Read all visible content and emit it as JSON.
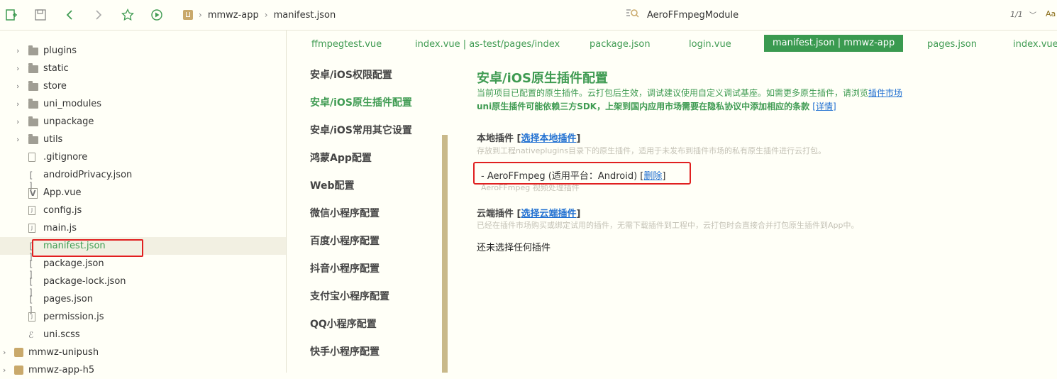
{
  "toolbar": {
    "breadcrumb": [
      "mmwz-app",
      "manifest.json"
    ],
    "search_value": "AeroFFmpegModule",
    "search_count": "1/1",
    "case_label": "Aa"
  },
  "sidebar": {
    "items": [
      {
        "label": "plugins",
        "type": "folder"
      },
      {
        "label": "static",
        "type": "folder"
      },
      {
        "label": "store",
        "type": "folder"
      },
      {
        "label": "uni_modules",
        "type": "folder"
      },
      {
        "label": "unpackage",
        "type": "folder"
      },
      {
        "label": "utils",
        "type": "folder"
      },
      {
        "label": ".gitignore",
        "type": "file"
      },
      {
        "label": "androidPrivacy.json",
        "type": "json"
      },
      {
        "label": "App.vue",
        "type": "vue"
      },
      {
        "label": "config.js",
        "type": "js"
      },
      {
        "label": "main.js",
        "type": "js"
      },
      {
        "label": "manifest.json",
        "type": "json",
        "selected": true
      },
      {
        "label": "package.json",
        "type": "json"
      },
      {
        "label": "package-lock.json",
        "type": "json"
      },
      {
        "label": "pages.json",
        "type": "json"
      },
      {
        "label": "permission.js",
        "type": "js"
      },
      {
        "label": "uni.scss",
        "type": "scss"
      },
      {
        "label": "mmwz-unipush",
        "type": "project"
      },
      {
        "label": "mmwz-app-h5",
        "type": "project"
      }
    ]
  },
  "tabs": [
    {
      "label": "ffmpegtest.vue"
    },
    {
      "label": "index.vue | as-test/pages/index"
    },
    {
      "label": "package.json"
    },
    {
      "label": "login.vue"
    },
    {
      "label": "manifest.json | mmwz-app",
      "active": true
    },
    {
      "label": "pages.json"
    },
    {
      "label": "index.vue"
    }
  ],
  "settings_nav": [
    {
      "label": "安卓/iOS权限配置"
    },
    {
      "label": "安卓/iOS原生插件配置",
      "active": true
    },
    {
      "label": "安卓/iOS常用其它设置"
    },
    {
      "label": "鸿蒙App配置"
    },
    {
      "label": "Web配置"
    },
    {
      "label": "微信小程序配置"
    },
    {
      "label": "百度小程序配置"
    },
    {
      "label": "抖音小程序配置"
    },
    {
      "label": "支付宝小程序配置"
    },
    {
      "label": "QQ小程序配置"
    },
    {
      "label": "快手小程序配置"
    }
  ],
  "main": {
    "title": "安卓/iOS原生插件配置",
    "desc1_text": "当前项目已配置的原生插件。云打包后生效，调试建议使用自定义调试基座。如需更多原生插件，请浏览",
    "desc1_link": "插件市场",
    "desc2_text": "uni原生插件可能依赖三方SDK，上架到国内应用市场需要在隐私协议中添加相应的条款",
    "desc2_link": "[详情]",
    "local_section": {
      "title": "本地插件",
      "action": "选择本地插件",
      "hint": "存放到工程nativeplugins目录下的原生插件，适用于未发布到插件市场的私有原生插件进行云打包。"
    },
    "plugin": {
      "text": "- AeroFFmpeg (适用平台：Android)",
      "delete_label": "删除",
      "desc": "AeroFFmpeg 视频处理插件"
    },
    "cloud_section": {
      "title": "云端插件",
      "action": "选择云端插件",
      "hint": "已经在插件市场购买或绑定试用的插件，无需下载插件到工程中，云打包时会直接合并打包原生插件到App中。"
    },
    "empty_text": "还未选择任何插件"
  },
  "colors": {
    "accent_green": "#3f9b52",
    "link_blue": "#1f6fd1",
    "highlight_red": "#e02020",
    "background": "#fffff7"
  }
}
